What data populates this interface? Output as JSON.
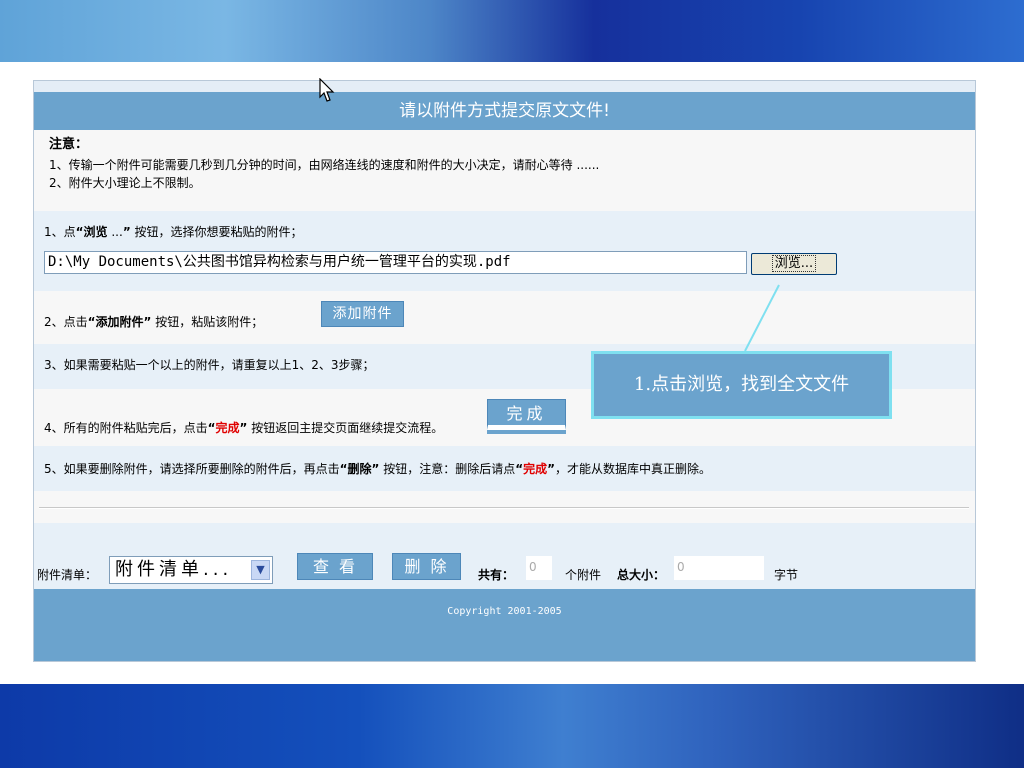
{
  "page": {
    "title": "请以附件方式提交原文文件!",
    "notice": {
      "head": "注意：",
      "line1": "1、传输一个附件可能需要几秒到几分钟的时间，由网络连线的速度和附件的大小决定，请耐心等待 ......",
      "line2": "2、附件大小理论上不限制。"
    },
    "step1": {
      "prefix": "1、点",
      "quote_open": "“",
      "bold": "浏览",
      "mid": " ...",
      "quote_close": "”",
      "suffix": " 按钮，选择你想要粘贴的附件；"
    },
    "file_path": "D:\\My Documents\\公共图书馆异构检索与用户统一管理平台的实现.pdf",
    "browse_label": "浏览...",
    "step2": {
      "prefix": "2、点击",
      "bold": "“添加附件”",
      "suffix": " 按钮，粘贴该附件；"
    },
    "add_label": "添加附件",
    "step3": "3、如果需要粘贴一个以上的附件，请重复以上1、2、3步骤；",
    "step4": {
      "prefix": "4、所有的附件粘贴完后，点击",
      "q1": "“",
      "red": "完成",
      "q2": "”",
      "suffix": " 按钮返回主提交页面继续提交流程。"
    },
    "done_label": "完成",
    "step5": {
      "prefix": "5、如果要删除附件，请选择所要删除的附件后，再点击",
      "bold": "“删除”",
      "mid": " 按钮，注意：删除后请点",
      "q1": "“",
      "red": "完成",
      "q2": "”",
      "suffix": "，才能从数据库中真正删除。"
    },
    "list_label": "附件清单：",
    "list_select": "附件清单...",
    "view_label": "查看",
    "delete_label": "删除",
    "count_label": "共有：",
    "count_value": "0",
    "count_unit": "个附件",
    "size_label": "总大小：",
    "size_value": "0",
    "size_unit": "字节",
    "copyright": "Copyright 2001-2005"
  },
  "callout": {
    "text": "1.点击浏览，找到全文文件"
  },
  "colors": {
    "accent": "#6ba3cd",
    "callout_border": "#7fe0f0",
    "warning_red": "#e00000"
  }
}
